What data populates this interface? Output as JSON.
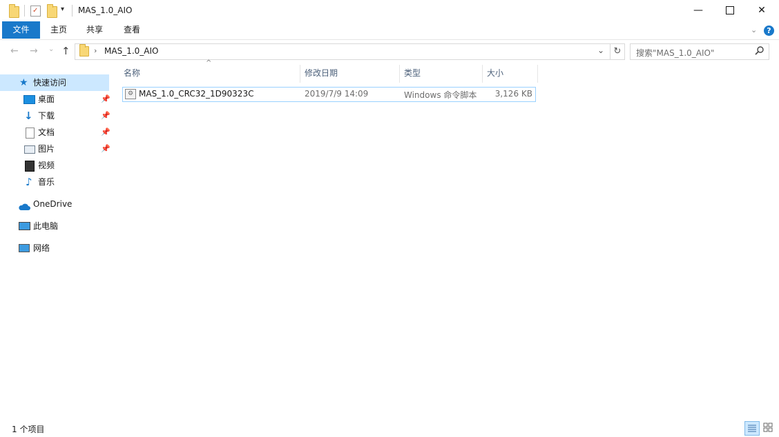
{
  "window": {
    "title": "MAS_1.0_AIO",
    "minimize_glyph": "—",
    "maximize_glyph": "☐",
    "close_glyph": "✕"
  },
  "ribbon": {
    "tabs": [
      {
        "label": "文件"
      },
      {
        "label": "主页"
      },
      {
        "label": "共享"
      },
      {
        "label": "查看"
      }
    ],
    "help_glyph": "?"
  },
  "address": {
    "path_segment": "MAS_1.0_AIO",
    "search_placeholder": "搜索\"MAS_1.0_AIO\""
  },
  "sidebar": {
    "quick_access": "快速访问",
    "items": [
      {
        "label": "桌面",
        "icon": "desktop-icon",
        "pinned": true
      },
      {
        "label": "下载",
        "icon": "download-icon",
        "pinned": true
      },
      {
        "label": "文档",
        "icon": "document-icon",
        "pinned": true
      },
      {
        "label": "图片",
        "icon": "pictures-icon",
        "pinned": true
      },
      {
        "label": "视频",
        "icon": "video-icon",
        "pinned": false
      },
      {
        "label": "音乐",
        "icon": "music-icon",
        "pinned": false
      }
    ],
    "onedrive": "OneDrive",
    "this_pc": "此电脑",
    "network": "网络"
  },
  "columns": {
    "name": "名称",
    "date": "修改日期",
    "type": "类型",
    "size": "大小"
  },
  "files": [
    {
      "name": "MAS_1.0_CRC32_1D90323C",
      "date": "2019/7/9 14:09",
      "type": "Windows 命令脚本",
      "size": "3,126 KB"
    }
  ],
  "status": {
    "count": "1 个项目"
  },
  "colors": {
    "accent": "#1979ca",
    "selection": "#cce8ff",
    "folder": "#f8d775"
  }
}
